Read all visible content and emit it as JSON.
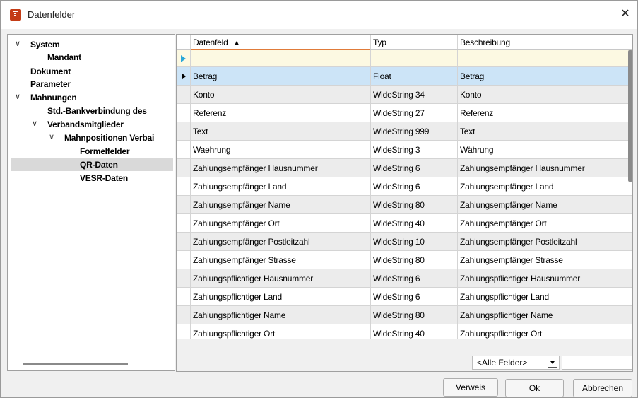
{
  "window": {
    "title": "Datenfelder"
  },
  "tree": {
    "items": [
      {
        "label": "System",
        "expanded": true
      },
      {
        "label": "Mandant"
      },
      {
        "label": "Dokument"
      },
      {
        "label": "Parameter"
      },
      {
        "label": "Mahnungen",
        "expanded": true
      },
      {
        "label": "Std.-Bankverbindung des"
      },
      {
        "label": "Verbandsmitglieder",
        "expanded": true
      },
      {
        "label": "Mahnpositionen Verbai",
        "expanded": true
      },
      {
        "label": "Formelfelder"
      },
      {
        "label": "QR-Daten",
        "selected": true
      },
      {
        "label": "VESR-Daten"
      }
    ]
  },
  "grid": {
    "columns": [
      "Datenfeld",
      "Typ",
      "Beschreibung"
    ],
    "sort_indicator": "▲",
    "rows": [
      {
        "datenfeld": "Betrag",
        "typ": "Float",
        "beschreibung": "Betrag"
      },
      {
        "datenfeld": "Konto",
        "typ": "WideString  34",
        "beschreibung": "Konto"
      },
      {
        "datenfeld": "Referenz",
        "typ": "WideString  27",
        "beschreibung": "Referenz"
      },
      {
        "datenfeld": "Text",
        "typ": "WideString  999",
        "beschreibung": "Text"
      },
      {
        "datenfeld": "Waehrung",
        "typ": "WideString  3",
        "beschreibung": "Währung"
      },
      {
        "datenfeld": "Zahlungsempfänger Hausnummer",
        "typ": "WideString  6",
        "beschreibung": "Zahlungsempfänger Hausnummer"
      },
      {
        "datenfeld": "Zahlungsempfänger Land",
        "typ": "WideString  6",
        "beschreibung": "Zahlungsempfänger Land"
      },
      {
        "datenfeld": "Zahlungsempfänger Name",
        "typ": "WideString  80",
        "beschreibung": "Zahlungsempfänger Name"
      },
      {
        "datenfeld": "Zahlungsempfänger Ort",
        "typ": "WideString  40",
        "beschreibung": "Zahlungsempfänger Ort"
      },
      {
        "datenfeld": "Zahlungsempfänger Postleitzahl",
        "typ": "WideString  10",
        "beschreibung": "Zahlungsempfänger Postleitzahl"
      },
      {
        "datenfeld": "Zahlungsempfänger Strasse",
        "typ": "WideString  80",
        "beschreibung": "Zahlungsempfänger Strasse"
      },
      {
        "datenfeld": "Zahlungspflichtiger Hausnummer",
        "typ": "WideString  6",
        "beschreibung": "Zahlungspflichtiger Hausnummer"
      },
      {
        "datenfeld": "Zahlungspflichtiger Land",
        "typ": "WideString  6",
        "beschreibung": "Zahlungspflichtiger Land"
      },
      {
        "datenfeld": "Zahlungspflichtiger Name",
        "typ": "WideString  80",
        "beschreibung": "Zahlungspflichtiger Name"
      },
      {
        "datenfeld": "Zahlungspflichtiger Ort",
        "typ": "WideString  40",
        "beschreibung": "Zahlungspflichtiger Ort"
      }
    ],
    "selected_row": 0
  },
  "filter": {
    "field_select_value": "<Alle Felder>",
    "search_value": ""
  },
  "buttons": {
    "verweis": "Verweis",
    "ok": "Ok",
    "abbrechen": "Abbrechen"
  },
  "icons": {
    "app": "app-document-icon",
    "close": "close-icon",
    "expand": "chevron-down-icon",
    "search": "search-icon"
  },
  "colors": {
    "selection": "#cce4f7",
    "filter_row": "#fcf9e2",
    "sort_underline": "#e07b3a",
    "new_row_indicator": "#29a8d8"
  }
}
